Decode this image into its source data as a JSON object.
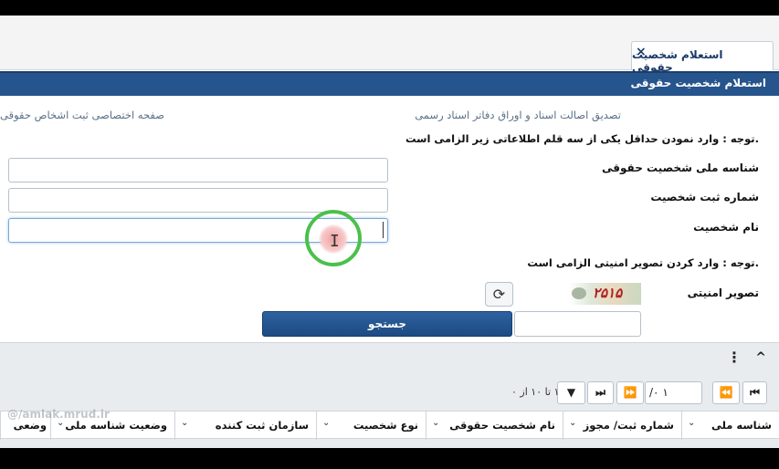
{
  "tab": {
    "label": "استعلام شخصیت حقوقی",
    "close": "×"
  },
  "header": {
    "title": "استعلام شخصیت حقوقی"
  },
  "links": {
    "authenticity": "تصدیق اصالت اسناد و اوراق دفاتر اسناد رسمی",
    "private_page": "صفحه اختصاصی ثبت اشخاص حقوقی"
  },
  "form": {
    "notice_fields": "توجه : وارد نمودن حداقل یکی از سه قلم اطلاعاتی زیر الزامی است.",
    "national_id_label": "شناسه ملی شخصیت حقوقی",
    "national_id_value": "",
    "reg_number_label": "شماره ثبت شخصیت",
    "reg_number_value": "",
    "name_label": "نام شخصیت",
    "name_value": "",
    "notice_captcha": "توجه : وارد کردن تصویر امنیتی الزامی است.",
    "captcha_label": "تصویر امنیتی",
    "captcha_text": "۲۵۱۵",
    "captcha_value": "",
    "search_button": "جستجو"
  },
  "grid": {
    "collapse_icon": "^",
    "menu_icon": "⋮",
    "pager": {
      "page_value": "۱",
      "page_of": "/۰",
      "info": "۱ تا ۱۰ از ۰"
    },
    "columns": [
      "شناسه ملی",
      "شماره ثبت/ مجوز",
      "نام شخصیت حقوقی",
      "نوع شخصیت",
      "سازمان ثبت کننده",
      "وضعیت شناسه ملی",
      "وضعی"
    ]
  },
  "watermark": "@/amlak.mrud.ir"
}
